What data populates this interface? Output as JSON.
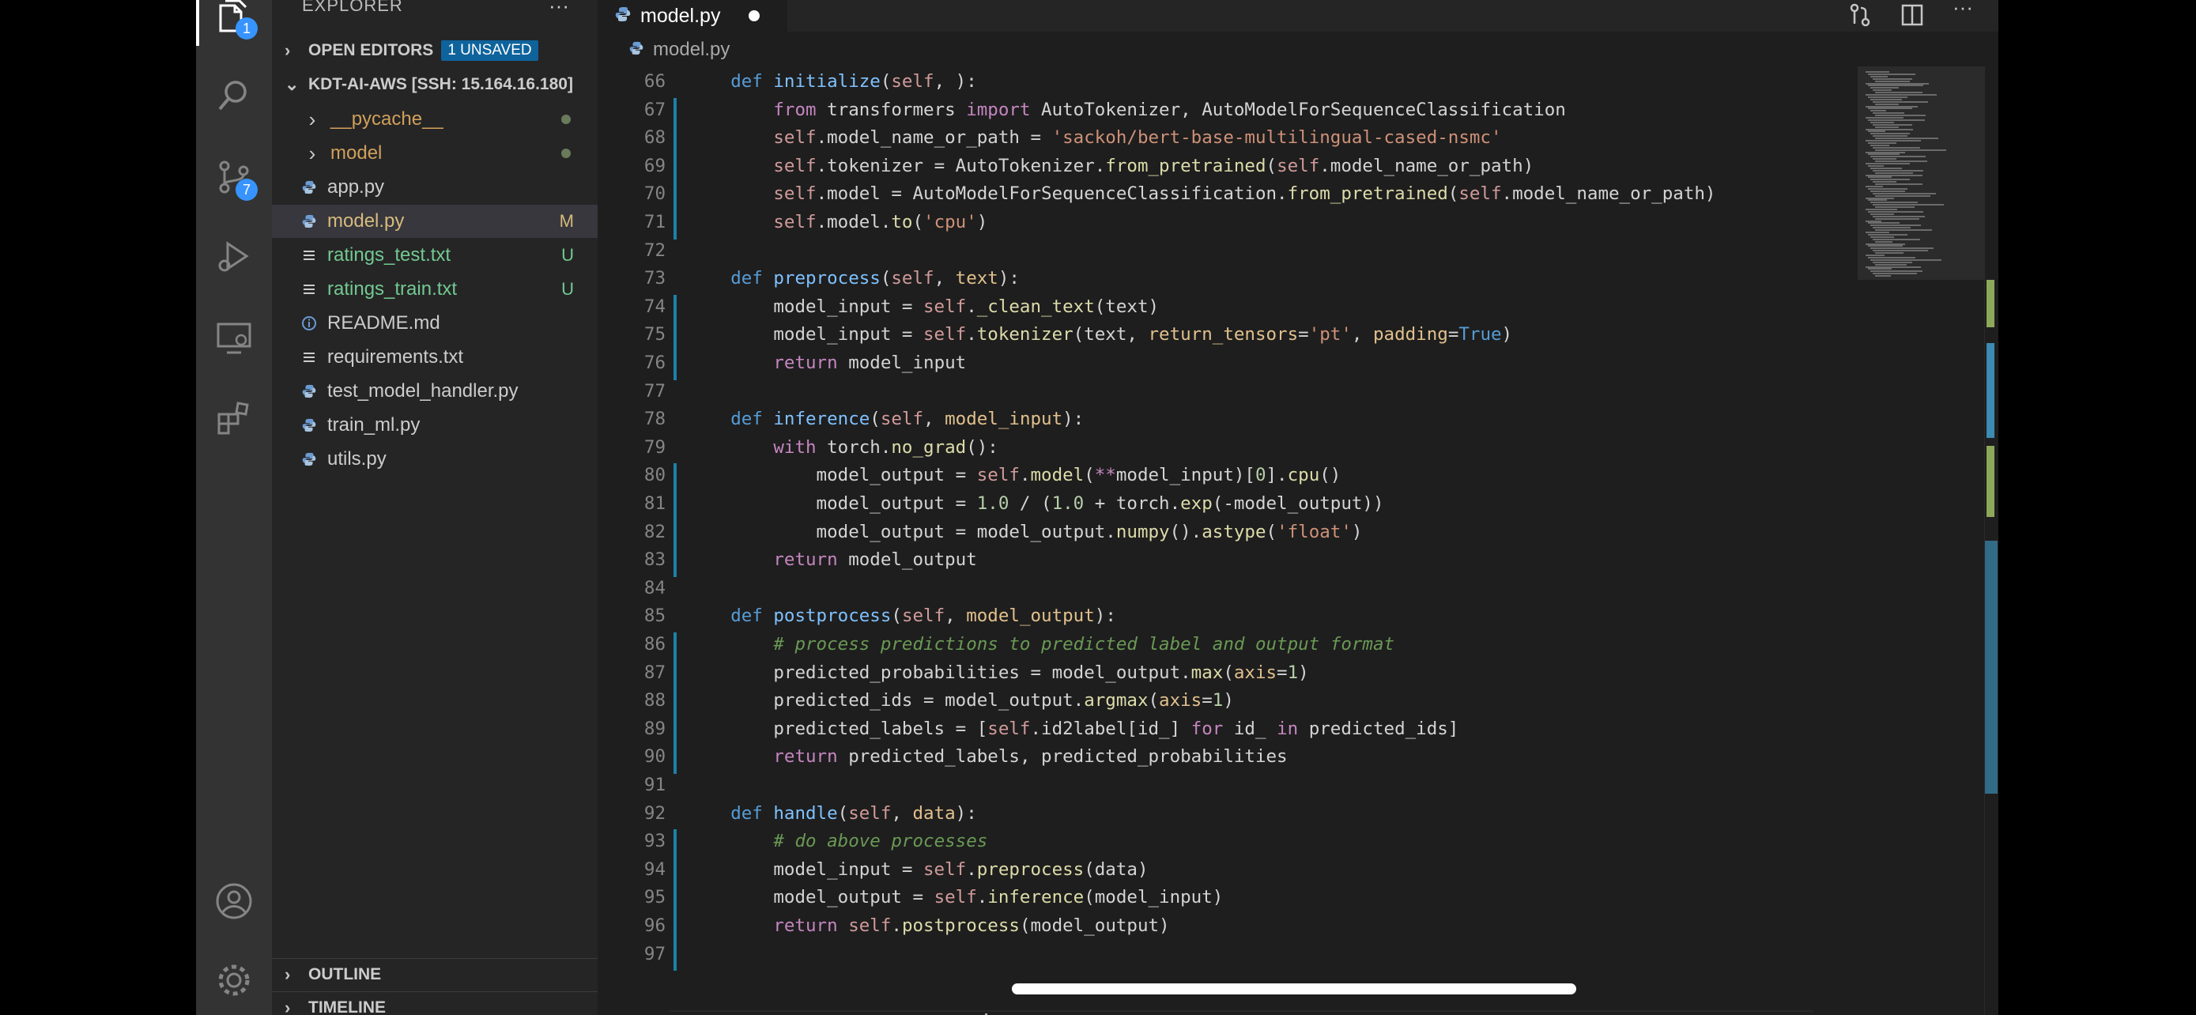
{
  "activity": {
    "explorer_badge": "1",
    "scm_badge": "7"
  },
  "sidebar": {
    "title": "EXPLORER",
    "more": "···",
    "open_editors": {
      "label": "OPEN EDITORS",
      "badge": "1 UNSAVED"
    },
    "workspace": {
      "label": "KDT-AI-AWS [SSH: 15.164.16.180]"
    },
    "files": [
      {
        "name": "__pycache__",
        "kind": "folder",
        "color": "#cfa05a",
        "status": "dot"
      },
      {
        "name": "model",
        "kind": "folder",
        "color": "#cfa05a",
        "status": "dot"
      },
      {
        "name": "app.py",
        "kind": "python",
        "color": "#cccccc",
        "status": ""
      },
      {
        "name": "model.py",
        "kind": "python",
        "color": "#d7ba7d",
        "status": "M"
      },
      {
        "name": "ratings_test.txt",
        "kind": "text",
        "color": "#73c991",
        "status": "U"
      },
      {
        "name": "ratings_train.txt",
        "kind": "text",
        "color": "#73c991",
        "status": "U"
      },
      {
        "name": "README.md",
        "kind": "info",
        "color": "#cccccc",
        "status": ""
      },
      {
        "name": "requirements.txt",
        "kind": "text",
        "color": "#cccccc",
        "status": ""
      },
      {
        "name": "test_model_handler.py",
        "kind": "python",
        "color": "#cccccc",
        "status": ""
      },
      {
        "name": "train_ml.py",
        "kind": "python",
        "color": "#cccccc",
        "status": ""
      },
      {
        "name": "utils.py",
        "kind": "python",
        "color": "#cccccc",
        "status": ""
      }
    ],
    "outline_label": "OUTLINE",
    "timeline_label": "TIMELINE"
  },
  "editor": {
    "tab_label": "model.py",
    "breadcrumb": "model.py",
    "line_numbers": [
      "66",
      "67",
      "68",
      "69",
      "70",
      "71",
      "72",
      "73",
      "74",
      "75",
      "76",
      "77",
      "78",
      "79",
      "80",
      "81",
      "82",
      "83",
      "84",
      "85",
      "86",
      "87",
      "88",
      "89",
      "90",
      "91",
      "92",
      "93",
      "94",
      "95",
      "96",
      "97"
    ],
    "lines": [
      "    def initialize(self, ):",
      "        from transformers import AutoTokenizer, AutoModelForSequenceClassification",
      "        self.model_name_or_path = 'sackoh/bert-base-multilingual-cased-nsmc'",
      "        self.tokenizer = AutoTokenizer.from_pretrained(self.model_name_or_path)",
      "        self.model = AutoModelForSequenceClassification.from_pretrained(self.model_name_or_path)",
      "        self.model.to('cpu')",
      "",
      "    def preprocess(self, text):",
      "        model_input = self._clean_text(text)",
      "        model_input = self.tokenizer(text, return_tensors='pt', padding=True)",
      "        return model_input",
      "",
      "    def inference(self, model_input):",
      "        with torch.no_grad():",
      "            model_output = self.model(**model_input)[0].cpu()",
      "            model_output = 1.0 / (1.0 + torch.exp(-model_output))",
      "            model_output = model_output.numpy().astype('float')",
      "        return model_output",
      "",
      "    def postprocess(self, model_output):",
      "        # process predictions to predicted label and output format",
      "        predicted_probabilities = model_output.max(axis=1)",
      "        predicted_ids = model_output.argmax(axis=1)",
      "        predicted_labels = [self.id2label[id_] for id_ in predicted_ids]",
      "        return predicted_labels, predicted_probabilities",
      "",
      "    def handle(self, data):",
      "        # do above processes",
      "        model_input = self.preprocess(data)",
      "        model_output = self.inference(model_input)",
      "        return self.postprocess(model_output)",
      ""
    ]
  }
}
